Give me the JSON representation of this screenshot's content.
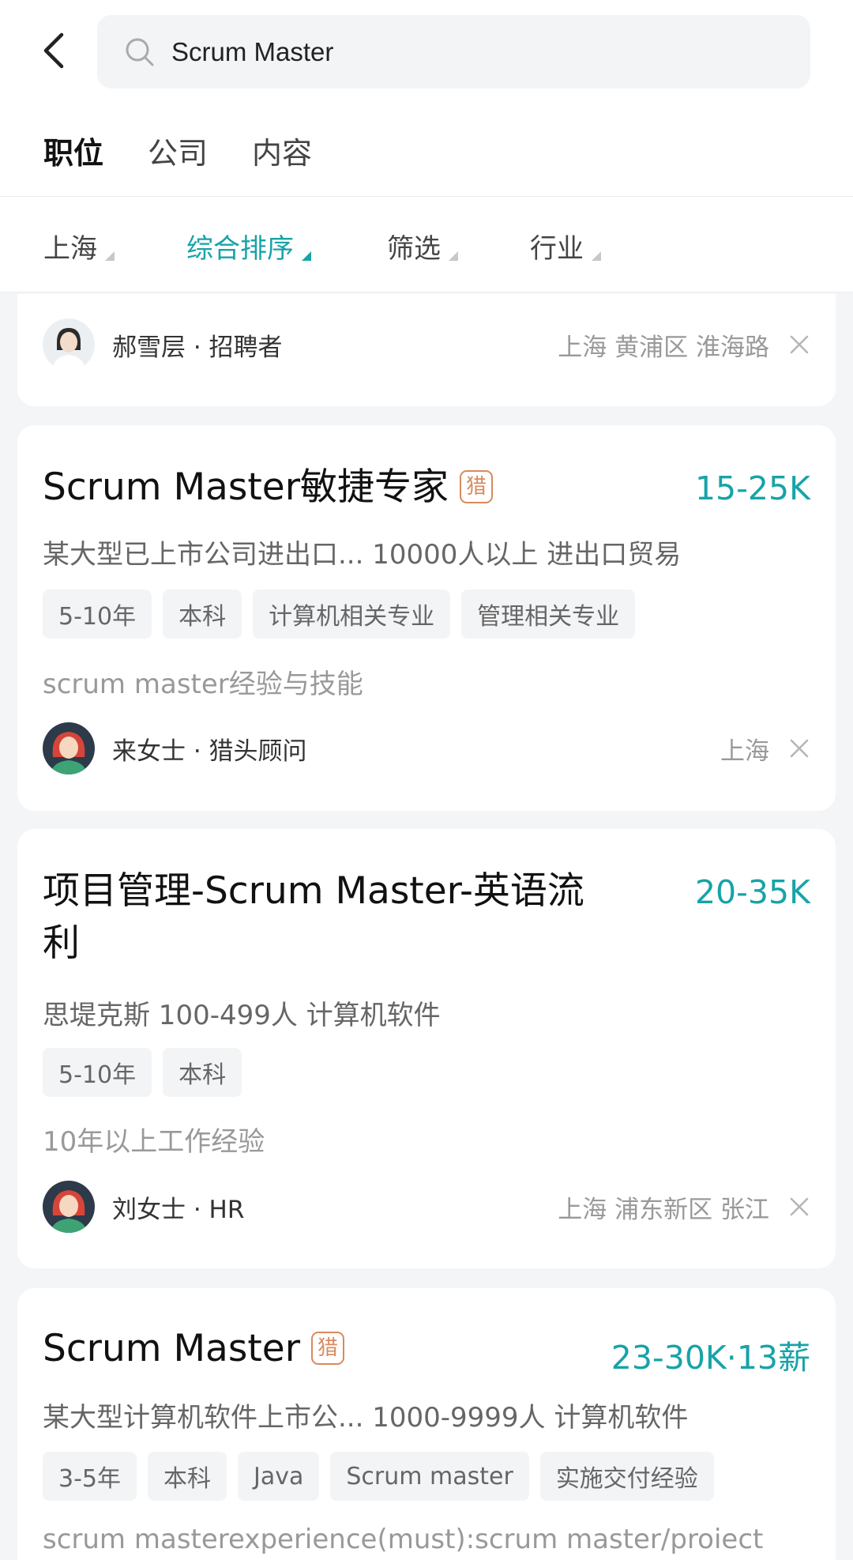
{
  "search": {
    "query": "Scrum Master"
  },
  "tabs": [
    {
      "label": "职位",
      "active": true
    },
    {
      "label": "公司",
      "active": false
    },
    {
      "label": "内容",
      "active": false
    }
  ],
  "filters": [
    {
      "label": "上海",
      "active": false
    },
    {
      "label": "综合排序",
      "active": true
    },
    {
      "label": "筛选",
      "active": false
    },
    {
      "label": "行业",
      "active": false
    }
  ],
  "accent_color": "#17a3a8",
  "partial_card": {
    "recruiter": "郝雪层 · 招聘者",
    "location": "上海 黄浦区 淮海路"
  },
  "jobs": [
    {
      "title": "Scrum Master敏捷专家",
      "badge": "猎",
      "salary": "15-25K",
      "company": "某大型已上市公司进出口... 10000人以上 进出口贸易",
      "tags": [
        "5-10年",
        "本科",
        "计算机相关专业",
        "管理相关专业"
      ],
      "desc": "scrum master经验与技能",
      "recruiter": "来女士 · 猎头顾问",
      "location": "上海"
    },
    {
      "title_line1": "项目管理-Scrum Master-英语流",
      "title_line2": "利",
      "salary": "20-35K",
      "company": "思堤克斯 100-499人 计算机软件",
      "tags": [
        "5-10年",
        "本科"
      ],
      "desc": "10年以上工作经验",
      "recruiter": "刘女士 · HR",
      "location": "上海 浦东新区 张江"
    },
    {
      "title": "Scrum Master",
      "badge": "猎",
      "salary": "23-30K·13薪",
      "company": "某大型计算机软件上市公... 1000-9999人 计算机软件",
      "tags": [
        "3-5年",
        "本科",
        "Java",
        "Scrum master",
        "实施交付经验"
      ],
      "desc": "scrum masterexperience(must):scrum master/proiect"
    }
  ]
}
